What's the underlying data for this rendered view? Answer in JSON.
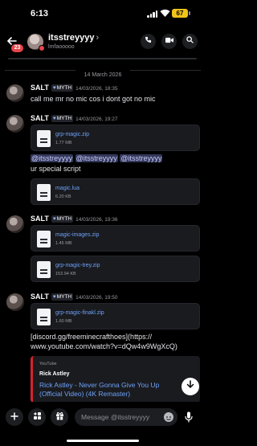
{
  "status_bar": {
    "time": "6:13",
    "battery": "67"
  },
  "header": {
    "back_icon": "arrow-left-icon",
    "unread_count": "23",
    "username": "itsstreyyyy",
    "chevron": "›",
    "status_text": "lmfaooooo",
    "actions": [
      "phone-icon",
      "video-icon",
      "search-icon"
    ]
  },
  "date_divider": "14 March 2026",
  "messages": [
    {
      "author": "SALT",
      "tag_icon": "♥",
      "tag": "MYTH",
      "timestamp": "14/03/2026, 18:35",
      "text": "call me mr no mic cos i dont got no mic"
    },
    {
      "author": "SALT",
      "tag_icon": "♥",
      "tag": "MYTH",
      "timestamp": "14/03/2026, 19:27",
      "file": {
        "name": "grp-magic.zip",
        "size": "1.77 MB"
      },
      "mentions": [
        "@itsstreyyyy",
        "@itsstreyyyy",
        "@itsstreyyyy"
      ],
      "text": "ur special script",
      "file2": {
        "name": "magic.lua",
        "size": "6.20 KB"
      }
    },
    {
      "author": "SALT",
      "tag_icon": "♥",
      "tag": "MYTH",
      "timestamp": "14/03/2026, 19:36",
      "files": [
        {
          "name": "magic-images.zip",
          "size": "1.45 MB"
        },
        {
          "name": "grp-magic-trey.zip",
          "size": "153.94 KB"
        }
      ]
    },
    {
      "author": "SALT",
      "tag_icon": "♥",
      "tag": "MYTH",
      "timestamp": "14/03/2026, 19:50",
      "file": {
        "name": "grp-magic-finakl.zip",
        "size": "1.60 MB"
      },
      "text_line1": "[discord.gg/freeminecrafthoes](https://",
      "text_line2": "www.youtube.com/watch?v=dQw4w9WgXcQ)",
      "embed": {
        "provider": "YouTube",
        "author": "Rick Astley",
        "title": "Rick Astley - Never Gonna Give You Up (Official Video) (4K Remaster)"
      }
    }
  ],
  "composer": {
    "placeholder": "Message @itsstreyyyy",
    "buttons": [
      "plus-icon",
      "apps-icon",
      "gift-icon"
    ],
    "mic": "microphone-icon",
    "emoji": "emoji-icon"
  },
  "scroll_down_icon": "arrow-down-icon"
}
